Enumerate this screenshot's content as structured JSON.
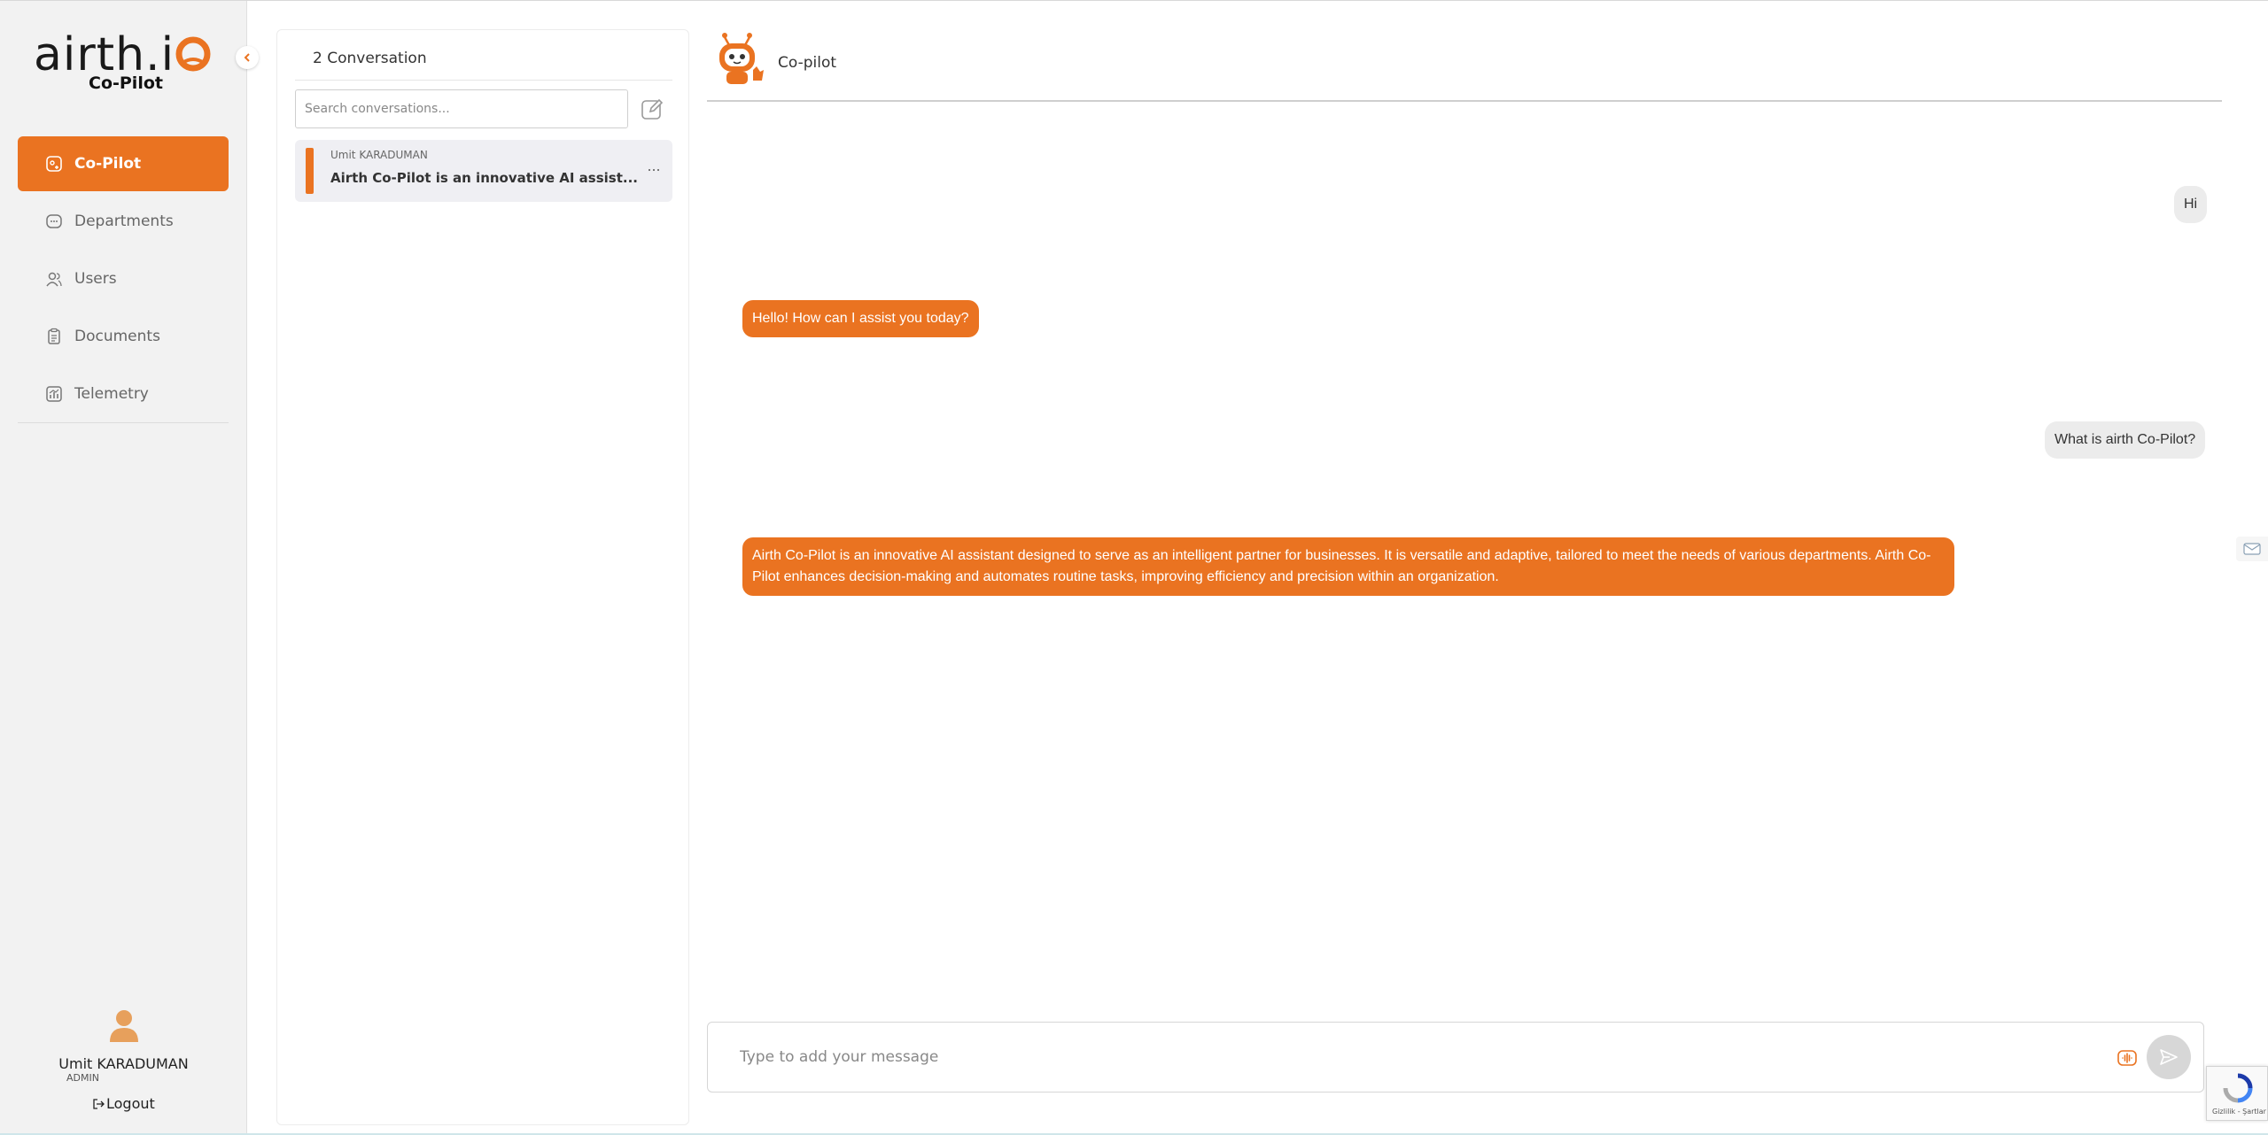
{
  "brand": {
    "logo_text": "airth.i",
    "subtitle": "Co-Pilot",
    "accent_color": "#ea7321"
  },
  "sidebar": {
    "items": [
      {
        "label": "Co-Pilot",
        "icon": "copilot-icon",
        "active": true
      },
      {
        "label": "Departments",
        "icon": "departments-icon",
        "active": false
      },
      {
        "label": "Users",
        "icon": "users-icon",
        "active": false
      },
      {
        "label": "Documents",
        "icon": "documents-icon",
        "active": false
      },
      {
        "label": "Telemetry",
        "icon": "telemetry-icon",
        "active": false
      }
    ],
    "user": {
      "name": "Umit KARADUMAN",
      "role": "ADMIN",
      "logout_label": "Logout"
    }
  },
  "conversations": {
    "header": "2 Conversation",
    "search_placeholder": "Search conversations...",
    "items": [
      {
        "user": "Umit KARADUMAN",
        "title": "Airth Co-Pilot is an innovative AI assist...",
        "more": "..."
      }
    ]
  },
  "chat": {
    "bot_name": "Co-pilot",
    "messages": [
      {
        "role": "user",
        "text": "Hi"
      },
      {
        "role": "bot",
        "text": "Hello! How can I assist you today?"
      },
      {
        "role": "user",
        "text": "What is airth Co-Pilot?"
      },
      {
        "role": "bot",
        "text": "Airth Co-Pilot is an innovative AI assistant designed to serve as an intelligent partner for businesses. It is versatile and adaptive, tailored to meet the needs of various departments. Airth Co-Pilot enhances decision-making and automates routine tasks, improving efficiency and precision within an organization."
      }
    ],
    "composer_placeholder": "Type to add your message"
  },
  "recaptcha": {
    "footer_text": "Gizlilik - Şartlar"
  }
}
